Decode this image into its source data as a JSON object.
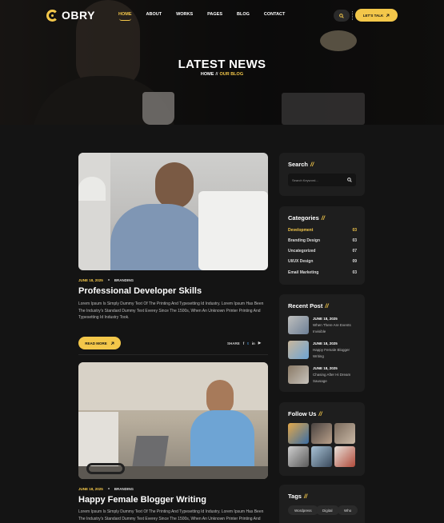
{
  "header": {
    "logo_text": "OBRY",
    "nav": [
      "HOME",
      "ABOUT",
      "WORKS",
      "PAGES",
      "BLOG",
      "CONTACT"
    ],
    "cta_label": "LET'S TALK"
  },
  "hero": {
    "title": "LATEST NEWS",
    "crumb_home": "HOME",
    "crumb_sep": "//",
    "crumb_current": "OUR BLOG"
  },
  "posts": [
    {
      "date": "JUNE 18, 2025",
      "category": "BRANDING",
      "title": "Professional Developer Skills",
      "excerpt": "Lorem Ipsum Is Simply Dummy Text Of The Printing And Typesetting Id Industry. Lorem Ipsum Has Been The Industry's Standard Dummy Text Everey Since The 1500s, When An Unknown Printer Printing And Typesetting Id Industry Took.",
      "read_more": "READ MORE",
      "share_label": "SHARE"
    },
    {
      "date": "JUNE 18, 2025",
      "category": "BRANDING",
      "title": "Happy Female Blogger Writing",
      "excerpt": "Lorem Ipsum Is Simply Dummy Text Of The Printing And Typesetting Id Industry. Lorem Ipsum Has Been The Industry's Standard Dummy Text Everey Since The 1500s, When An Unknown Printer Printing And"
    }
  ],
  "sidebar": {
    "search_title": "Search",
    "search_placeholder": "Search Keyword...",
    "categories_title": "Categories",
    "categories": [
      {
        "name": "Development",
        "count": "03"
      },
      {
        "name": "Branding Design",
        "count": "03"
      },
      {
        "name": "Uncategorized",
        "count": "07"
      },
      {
        "name": "UI/UX Design",
        "count": "09"
      },
      {
        "name": "Email Marketing",
        "count": "03"
      }
    ],
    "recent_title": "Recent Post",
    "recent": [
      {
        "date": "JUNE 18, 2025",
        "title": "When There Are Events Invisible"
      },
      {
        "date": "JUNE 18, 2025",
        "title": "Happy Female Blogger Writing"
      },
      {
        "date": "JUNE 18, 2025",
        "title": "Chasing After Hi Dream Sausage"
      }
    ],
    "follow_title": "Follow Us",
    "tags_title": "Tags",
    "tags": [
      "Wordpress",
      "Digital",
      "Who"
    ]
  },
  "colors": {
    "accent": "#f3c74a",
    "background": "#141414",
    "card": "#1e1e1e"
  },
  "icons": [
    "search-icon",
    "arrow-up-right-icon",
    "facebook-icon",
    "twitter-icon",
    "linkedin-icon",
    "youtube-icon"
  ]
}
